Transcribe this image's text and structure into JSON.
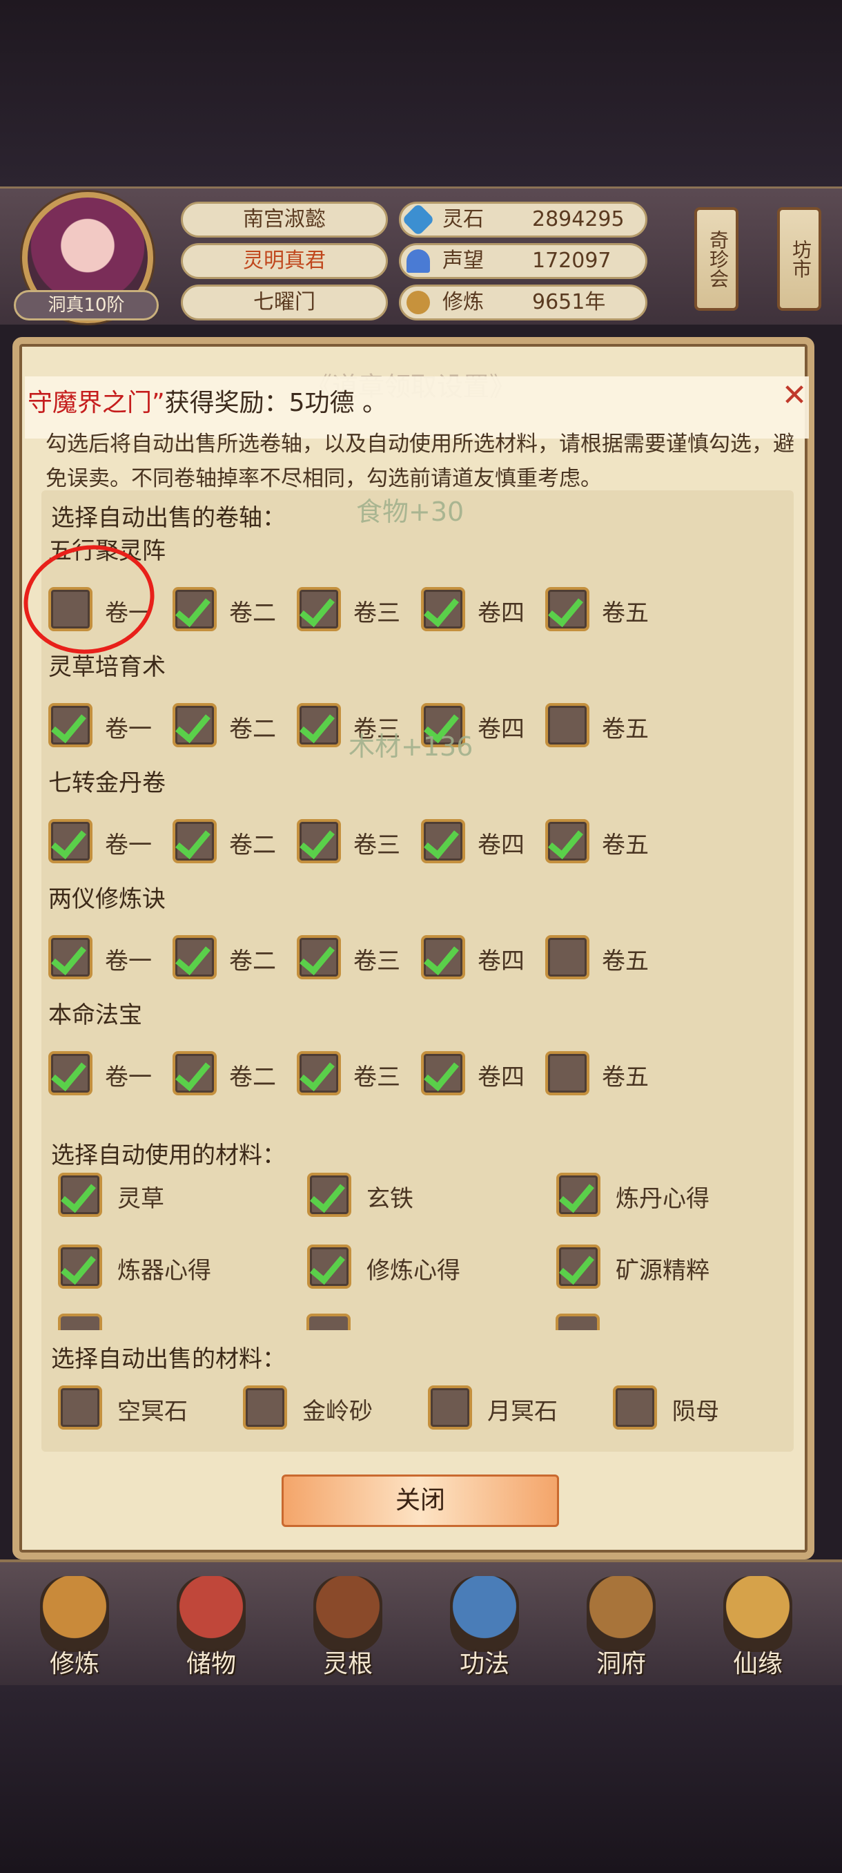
{
  "header": {
    "rank_badge": "洞真10阶",
    "names": [
      "南宫淑懿",
      "灵明真君",
      "七曜门"
    ],
    "stats": [
      {
        "label": "灵石",
        "value": "2894295",
        "icon": "spirit-stone-icon",
        "color": "#3c8fd1"
      },
      {
        "label": "声望",
        "value": "172097",
        "icon": "prestige-crystal-icon",
        "color": "#4a7bd4"
      },
      {
        "label": "修炼",
        "value": "9651年",
        "icon": "meditation-icon",
        "color": "#c7923c"
      }
    ],
    "signs": [
      "奇珍会",
      "坊市"
    ]
  },
  "dialog": {
    "title": "《道章领取设置》",
    "notification": {
      "prefix": "守魔界之门”",
      "suffix": "获得奖励：5功德 。"
    },
    "description": "勾选后将自动出售所选卷轴，以及自动使用所选材料，请根据需要谨慎勾选，避免误卖。不同卷轴掉率不尽相同，勾选前请道友慎重考虑。",
    "scroll_section_label": "选择自动出售的卷轴：",
    "floaters": [
      "食物+30",
      "木材+136"
    ],
    "scroll_groups": [
      {
        "title": "五行聚灵阵",
        "items": [
          {
            "label": "卷一",
            "checked": false
          },
          {
            "label": "卷二",
            "checked": true
          },
          {
            "label": "卷三",
            "checked": true
          },
          {
            "label": "卷四",
            "checked": true
          },
          {
            "label": "卷五",
            "checked": true
          }
        ]
      },
      {
        "title": "灵草培育术",
        "items": [
          {
            "label": "卷一",
            "checked": true
          },
          {
            "label": "卷二",
            "checked": true
          },
          {
            "label": "卷三",
            "checked": true
          },
          {
            "label": "卷四",
            "checked": true
          },
          {
            "label": "卷五",
            "checked": false
          }
        ]
      },
      {
        "title": "七转金丹卷",
        "items": [
          {
            "label": "卷一",
            "checked": true
          },
          {
            "label": "卷二",
            "checked": true
          },
          {
            "label": "卷三",
            "checked": true
          },
          {
            "label": "卷四",
            "checked": true
          },
          {
            "label": "卷五",
            "checked": true
          }
        ]
      },
      {
        "title": "两仪修炼诀",
        "items": [
          {
            "label": "卷一",
            "checked": true
          },
          {
            "label": "卷二",
            "checked": true
          },
          {
            "label": "卷三",
            "checked": true
          },
          {
            "label": "卷四",
            "checked": true
          },
          {
            "label": "卷五",
            "checked": false
          }
        ]
      },
      {
        "title": "本命法宝",
        "items": [
          {
            "label": "卷一",
            "checked": true
          },
          {
            "label": "卷二",
            "checked": true
          },
          {
            "label": "卷三",
            "checked": true
          },
          {
            "label": "卷四",
            "checked": true
          },
          {
            "label": "卷五",
            "checked": false
          }
        ]
      }
    ],
    "use_section_label": "选择自动使用的材料：",
    "use_materials": [
      {
        "label": "灵草",
        "checked": true
      },
      {
        "label": "玄铁",
        "checked": true
      },
      {
        "label": "炼丹心得",
        "checked": true
      },
      {
        "label": "炼器心得",
        "checked": true
      },
      {
        "label": "修炼心得",
        "checked": true
      },
      {
        "label": "矿源精粹",
        "checked": true
      }
    ],
    "sell_section_label": "选择自动出售的材料：",
    "sell_materials": [
      {
        "label": "空冥石",
        "checked": false
      },
      {
        "label": "金岭砂",
        "checked": false
      },
      {
        "label": "月冥石",
        "checked": false
      },
      {
        "label": "陨母",
        "checked": false
      }
    ],
    "close_label": "关闭",
    "annotation_color": "#e8201a"
  },
  "nav": [
    {
      "label": "修炼",
      "icon": "cultivate-icon",
      "color": "#c98a3a"
    },
    {
      "label": "储物",
      "icon": "storage-bag-icon",
      "color": "#c0473a"
    },
    {
      "label": "灵根",
      "icon": "spirit-root-icon",
      "color": "#8a4a2a"
    },
    {
      "label": "功法",
      "icon": "technique-book-icon",
      "color": "#4a7db8"
    },
    {
      "label": "洞府",
      "icon": "cave-mansion-icon",
      "color": "#a8743a"
    },
    {
      "label": "仙缘",
      "icon": "immortal-fate-icon",
      "color": "#d6a24a"
    }
  ]
}
